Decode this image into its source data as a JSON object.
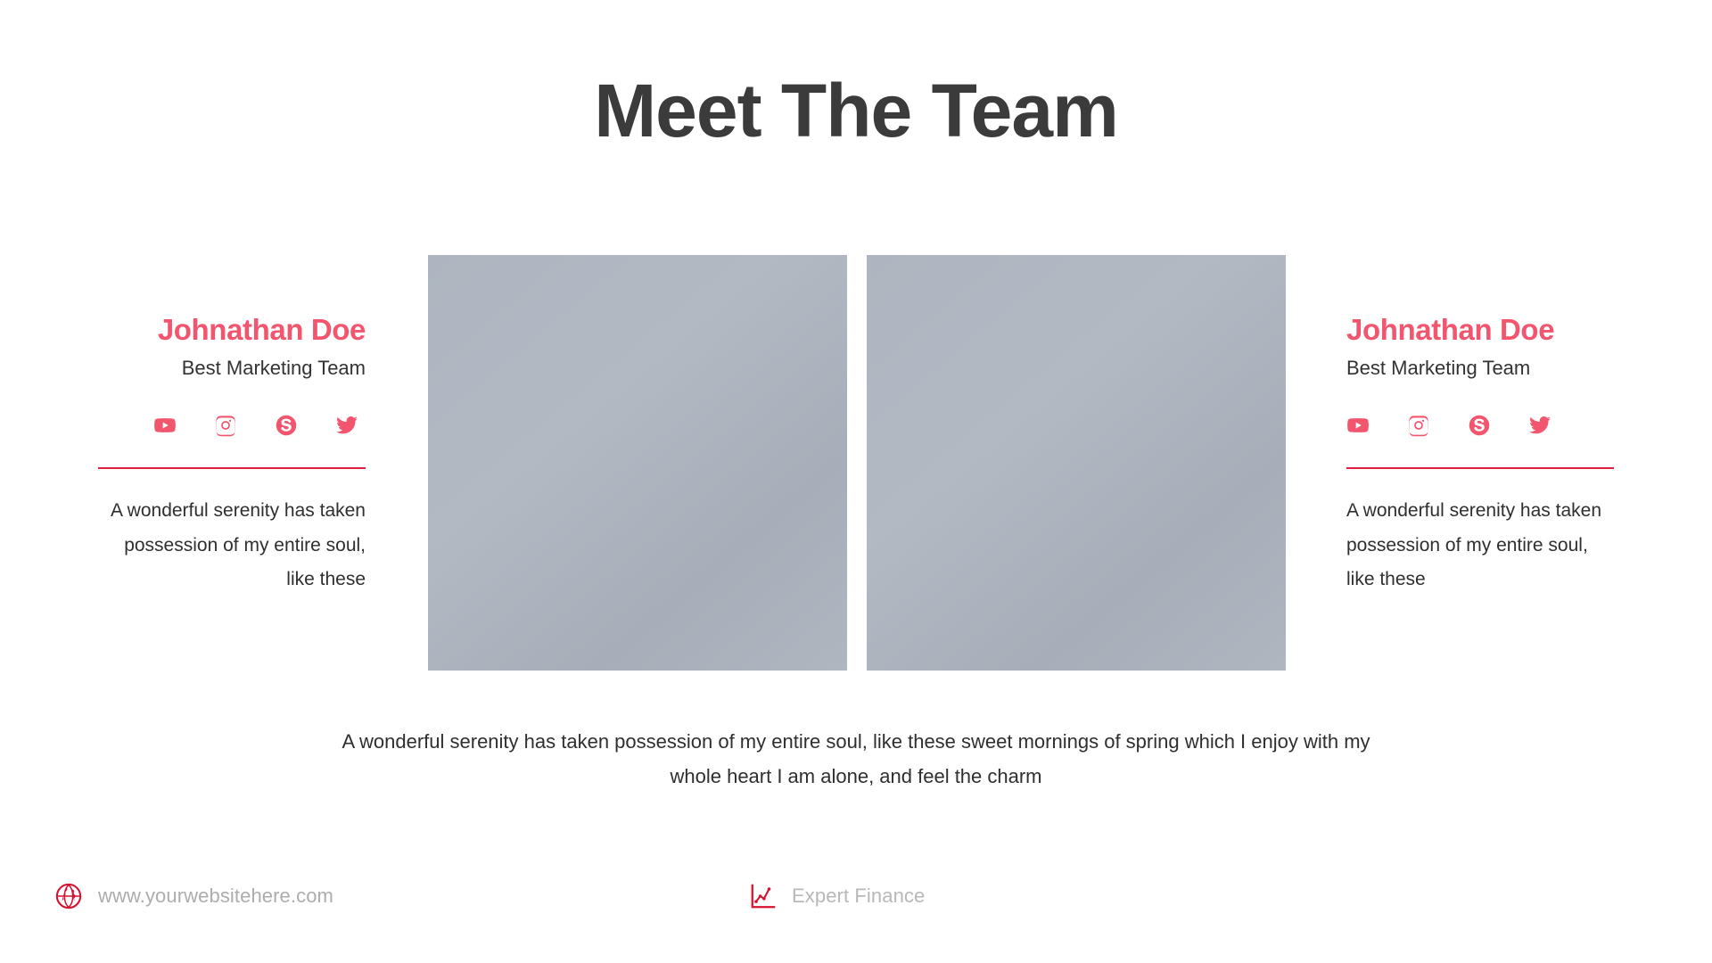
{
  "slide": {
    "title": "Meet The Team",
    "background_color": "#ffffff",
    "accent_pink": "#f2556e",
    "accent_red": "#e01e40",
    "title_color": "#3b3b3b"
  },
  "profiles": [
    {
      "name": "Johnathan Doe",
      "role": "Best Marketing Team",
      "body": "A wonderful serenity has taken possession of my entire soul, like these",
      "align": "right",
      "socials": [
        {
          "icon": "youtube-icon",
          "label": "YouTube"
        },
        {
          "icon": "instagram-icon",
          "label": "Instagram"
        },
        {
          "icon": "skype-icon",
          "label": "Skype"
        },
        {
          "icon": "twitter-icon",
          "label": "Twitter"
        }
      ]
    },
    {
      "name": "Johnathan Doe",
      "role": "Best Marketing Team",
      "body": "A wonderful serenity has taken possession of my entire soul, like these",
      "align": "left",
      "socials": [
        {
          "icon": "youtube-icon",
          "label": "YouTube"
        },
        {
          "icon": "instagram-icon",
          "label": "Instagram"
        },
        {
          "icon": "skype-icon",
          "label": "Skype"
        },
        {
          "icon": "twitter-icon",
          "label": "Twitter"
        }
      ]
    }
  ],
  "photos": [
    {
      "name": "team-photo-placeholder-1",
      "fill": "#aeb5c0"
    },
    {
      "name": "team-photo-placeholder-2",
      "fill": "#aeb5c0"
    }
  ],
  "bottom_text": "A wonderful serenity has taken possession of my entire soul, like these sweet mornings of spring which I enjoy with my whole heart I am alone, and feel the charm",
  "footer": {
    "website": {
      "icon": "globe-icon",
      "label": "www.yourwebsitehere.com"
    },
    "brand": {
      "icon": "line-chart-icon",
      "label": "Expert Finance"
    },
    "text_color": "#adadad",
    "icon_color": "#d81030"
  }
}
